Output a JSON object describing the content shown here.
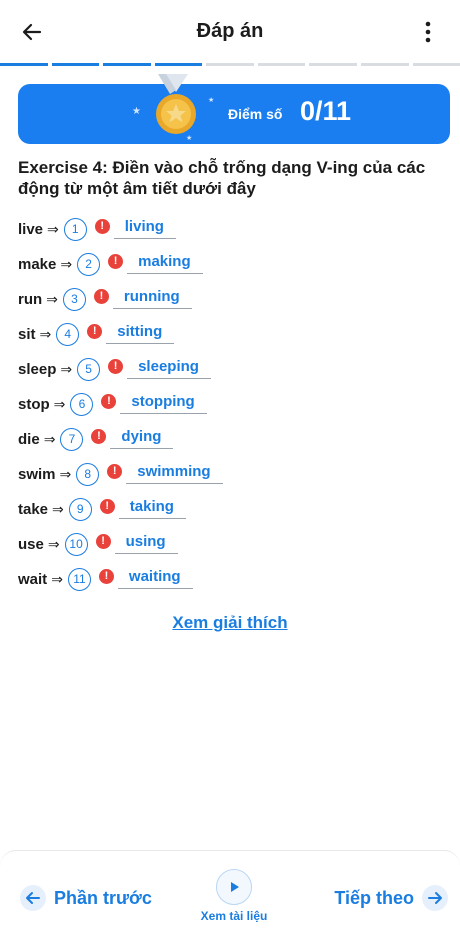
{
  "header": {
    "title": "Đáp án",
    "back_icon": "arrow-left-icon",
    "more_icon": "more-vertical-icon"
  },
  "progress": {
    "total": 9,
    "completed": 4
  },
  "score": {
    "label": "Điểm số",
    "value": "0/11"
  },
  "exercise": {
    "title": "Exercise 4: Điền vào chỗ trống dạng V-ing của các động từ một âm tiết dưới đây",
    "arrow": "⇒",
    "items": [
      {
        "verb": "live",
        "number": "1",
        "answer": "living"
      },
      {
        "verb": "make",
        "number": "2",
        "answer": "making"
      },
      {
        "verb": "run",
        "number": "3",
        "answer": "running"
      },
      {
        "verb": "sit",
        "number": "4",
        "answer": "sitting"
      },
      {
        "verb": "sleep",
        "number": "5",
        "answer": "sleeping"
      },
      {
        "verb": "stop",
        "number": "6",
        "answer": "stopping"
      },
      {
        "verb": "die",
        "number": "7",
        "answer": "dying"
      },
      {
        "verb": "swim",
        "number": "8",
        "answer": "swimming"
      },
      {
        "verb": "take",
        "number": "9",
        "answer": "taking"
      },
      {
        "verb": "use",
        "number": "10",
        "answer": "using"
      },
      {
        "verb": "wait",
        "number": "11",
        "answer": "waiting"
      }
    ]
  },
  "explain_link": "Xem giải thích",
  "footer": {
    "prev_label": "Phần trước",
    "doc_label": "Xem tài liệu",
    "next_label": "Tiếp theo"
  },
  "colors": {
    "accent": "#1a7de0",
    "error": "#e8423a",
    "banner": "#1a7ef0"
  }
}
